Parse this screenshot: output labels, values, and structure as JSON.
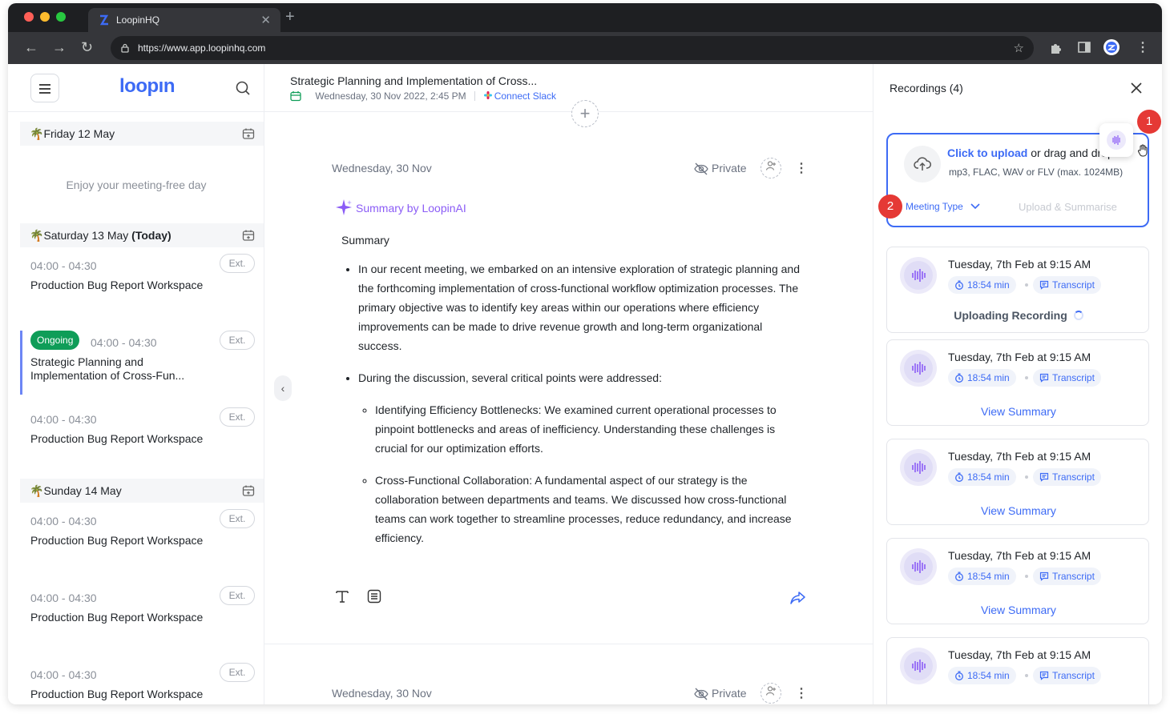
{
  "browser": {
    "tab_title": "LoopinHQ",
    "url": "https://www.app.loopinhq.com"
  },
  "sidebar": {
    "brand": "loopın",
    "days": [
      {
        "label": "Friday 12 May",
        "today_suffix": "",
        "empty_text": "Enjoy your meeting-free day"
      },
      {
        "label": "Saturday 13 May ",
        "today_suffix": "(Today)"
      },
      {
        "label": "Sunday 14 May",
        "today_suffix": ""
      }
    ],
    "events": [
      {
        "time": "04:00 - 04:30",
        "name": "Production Bug Report Workspace",
        "tag": "Ext."
      },
      {
        "status": "Ongoing",
        "time": "04:00 - 04:30",
        "name": "Strategic Planning and Implementation of Cross-Fun...",
        "tag": "Ext."
      },
      {
        "time": "04:00 - 04:30",
        "name": "Production Bug Report Workspace",
        "tag": "Ext."
      },
      {
        "time": "04:00 - 04:30",
        "name": "Production Bug Report Workspace",
        "tag": "Ext."
      },
      {
        "time": "04:00 - 04:30",
        "name": "Production Bug Report Workspace",
        "tag": "Ext."
      },
      {
        "time": "04:00 - 04:30",
        "name": "Production Bug Report Workspace",
        "tag": "Ext."
      }
    ]
  },
  "meeting": {
    "title": "Strategic Planning and Implementation of Cross...",
    "datetime": "Wednesday, 30 Nov 2022, 2:45 PM",
    "connect_slack": "Connect Slack"
  },
  "notes": [
    {
      "date": "Wednesday, 30 Nov",
      "privacy": "Private",
      "ai_title": "Summary by LoopinAI",
      "summary_label": "Summary",
      "bullets": [
        "In our recent meeting, we embarked on an intensive exploration of strategic planning and the forthcoming implementation of cross-functional workflow optimization processes. The primary objective was to identify key areas within our operations where efficiency improvements can be made to drive revenue growth and long-term organizational success.",
        "During the discussion, several critical points were addressed:"
      ],
      "sub_bullets": [
        "Identifying Efficiency Bottlenecks: We examined current operational processes to pinpoint bottlenecks and areas of inefficiency. Understanding these challenges is crucial for our optimization efforts.",
        "Cross-Functional Collaboration: A fundamental aspect of our strategy is the collaboration between departments and teams. We discussed how cross-functional teams can work together to streamline processes, reduce redundancy, and increase efficiency."
      ]
    },
    {
      "date": "Wednesday, 30 Nov",
      "privacy": "Private"
    }
  ],
  "recordings": {
    "title": "Recordings (4)",
    "upload": {
      "cta": "Click to upload",
      "rest": " or drag and drop",
      "formats": "mp3, FLAC, WAV or FLV (max. 1024MB)",
      "meeting_type": "Meeting Type",
      "summarise": "Upload & Summarise"
    },
    "badges": [
      "1",
      "2"
    ],
    "items": [
      {
        "title": "Tuesday, 7th Feb at 9:15 AM",
        "duration": "18:54 min",
        "transcript": "Transcript",
        "status": "Uploading Recording"
      },
      {
        "title": "Tuesday, 7th Feb at 9:15 AM",
        "duration": "18:54 min",
        "transcript": "Transcript",
        "action": "View Summary"
      },
      {
        "title": "Tuesday, 7th Feb at 9:15 AM",
        "duration": "18:54 min",
        "transcript": "Transcript",
        "action": "View Summary"
      },
      {
        "title": "Tuesday, 7th Feb at 9:15 AM",
        "duration": "18:54 min",
        "transcript": "Transcript",
        "action": "View Summary"
      },
      {
        "title": "Tuesday, 7th Feb at 9:15 AM",
        "duration": "18:54 min",
        "transcript": "Transcript"
      }
    ]
  },
  "colors": {
    "accent": "#3d6bf5",
    "ongoing": "#0f9d58",
    "ai": "#8b5cf6",
    "badge": "#e53935"
  }
}
